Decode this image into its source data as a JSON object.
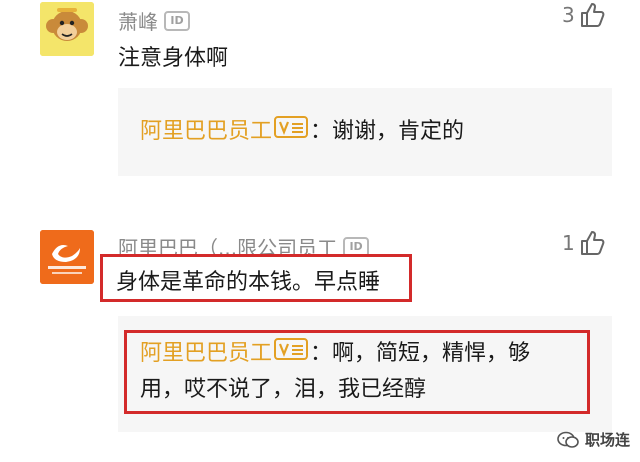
{
  "comments": [
    {
      "user": "萧峰",
      "badge": "ID",
      "likes": "3",
      "text": "注意身体啊",
      "reply": {
        "author": "阿里巴巴员工",
        "separator": "：",
        "text": "谢谢，肯定的"
      }
    },
    {
      "user": "阿里巴巴（...限公司员工",
      "badge": "ID",
      "likes": "1",
      "text": "身体是革命的本钱。早点睡",
      "reply": {
        "author": "阿里巴巴员工",
        "separator": "：",
        "text_line1": "啊，简短，精悍，够",
        "text_line2": "用，哎不说了，泪，我已经醇"
      }
    }
  ],
  "watermark": {
    "text": "职场连"
  },
  "icons": {
    "like": "thumbs-up-icon",
    "verified": "v-badge-icon",
    "id": "id-badge-icon"
  },
  "colors": {
    "replier": "#e3a023",
    "highlight_frame": "#d32a2a",
    "reply_bg": "#f6f6f6",
    "alibaba_orange": "#ef6b1b"
  }
}
